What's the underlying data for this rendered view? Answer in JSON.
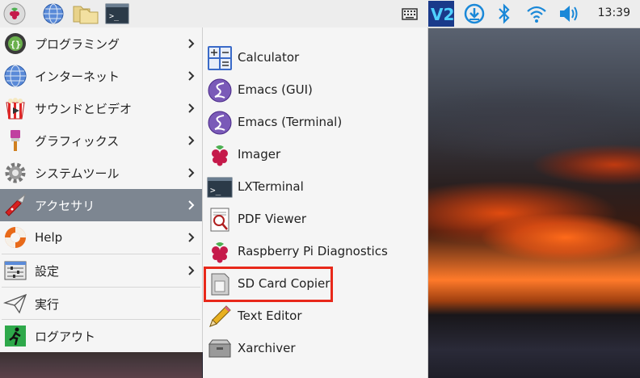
{
  "taskbar": {
    "clock": "13:39",
    "icons": [
      "raspberry-menu-icon",
      "web-browser-icon",
      "file-manager-icon",
      "terminal-icon",
      "keyboard-icon",
      "vnc-icon",
      "download-icon",
      "bluetooth-icon",
      "wifi-icon",
      "volume-icon"
    ]
  },
  "menu": {
    "items": [
      {
        "label": "プログラミング",
        "icon": "programming-icon"
      },
      {
        "label": "インターネット",
        "icon": "globe-icon"
      },
      {
        "label": "サウンドとビデオ",
        "icon": "sound-video-icon"
      },
      {
        "label": "グラフィックス",
        "icon": "graphics-brush-icon"
      },
      {
        "label": "システムツール",
        "icon": "system-gear-icon"
      },
      {
        "label": "アクセサリ",
        "icon": "accessories-knife-icon"
      },
      {
        "label": "Help",
        "icon": "help-lifebuoy-icon"
      },
      {
        "label": "設定",
        "icon": "settings-icon"
      },
      {
        "label": "実行",
        "icon": "run-paperplane-icon"
      },
      {
        "label": "ログアウト",
        "icon": "logout-icon"
      }
    ]
  },
  "submenu": {
    "items": [
      {
        "label": "Calculator",
        "icon": "calculator-icon"
      },
      {
        "label": "Emacs (GUI)",
        "icon": "emacs-icon"
      },
      {
        "label": "Emacs (Terminal)",
        "icon": "emacs-icon"
      },
      {
        "label": "Imager",
        "icon": "raspberry-icon"
      },
      {
        "label": "LXTerminal",
        "icon": "terminal-icon"
      },
      {
        "label": "PDF Viewer",
        "icon": "pdf-viewer-icon"
      },
      {
        "label": "Raspberry Pi Diagnostics",
        "icon": "raspberry-icon"
      },
      {
        "label": "SD Card Copier",
        "icon": "sd-card-icon"
      },
      {
        "label": "Text Editor",
        "icon": "text-editor-icon"
      },
      {
        "label": "Xarchiver",
        "icon": "archive-icon"
      }
    ]
  },
  "colors": {
    "active_item_bg": "#7d8691",
    "highlight_border": "#e8281a",
    "vnc_bg": "#1a3a8a"
  }
}
